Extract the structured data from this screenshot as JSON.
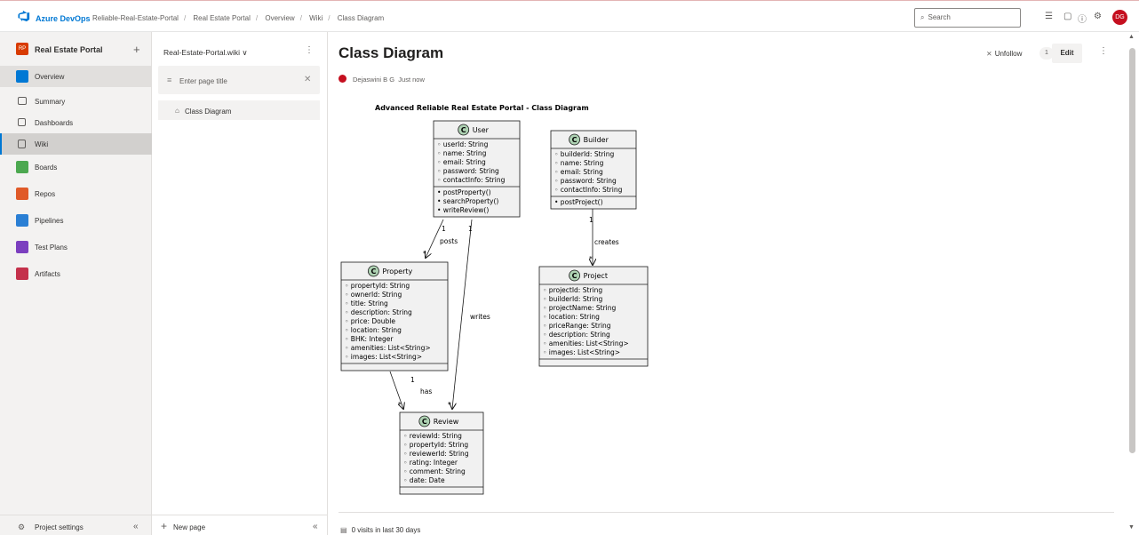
{
  "topbar": {
    "brand": "Azure DevOps",
    "breadcrumbs": [
      "Reliable-Real-Estate-Portal",
      "Real Estate Portal",
      "Overview",
      "Wiki",
      "Class Diagram"
    ],
    "search_placeholder": "Search",
    "avatar_initials": "DG"
  },
  "leftnav": {
    "project_name": "Real Estate Portal",
    "items": [
      {
        "label": "Overview",
        "icon": "overview-icon",
        "color": "#0078d4"
      },
      {
        "label": "Summary",
        "icon": "summary-icon"
      },
      {
        "label": "Dashboards",
        "icon": "dashboards-icon"
      },
      {
        "label": "Wiki",
        "icon": "wiki-icon"
      },
      {
        "label": "Boards",
        "icon": "boards-icon",
        "color": "#4ca850"
      },
      {
        "label": "Repos",
        "icon": "repos-icon",
        "color": "#e05a28"
      },
      {
        "label": "Pipelines",
        "icon": "pipelines-icon",
        "color": "#2a7fd4"
      },
      {
        "label": "Test Plans",
        "icon": "test-plans-icon",
        "color": "#7b3fbf"
      },
      {
        "label": "Artifacts",
        "icon": "artifacts-icon",
        "color": "#c4314b"
      }
    ],
    "project_settings": "Project settings"
  },
  "wiki": {
    "name": "Real-Estate-Portal.wiki",
    "filter_placeholder": "Enter page title",
    "tree_item": "Class Diagram",
    "new_page": "New page"
  },
  "page": {
    "title": "Class Diagram",
    "author": "Dejaswini B G",
    "time": "Just now",
    "unfollow": "Unfollow",
    "followers": "1",
    "edit": "Edit",
    "visits": "0 visits in last 30 days"
  },
  "diagram": {
    "title": "Advanced Reliable Real Estate Portal - Class Diagram",
    "classes": {
      "user": {
        "name": "User",
        "attrs": [
          "userId: String",
          "name: String",
          "email: String",
          "password: String",
          "contactInfo: String"
        ],
        "methods": [
          "postProperty()",
          "searchProperty()",
          "writeReview()"
        ]
      },
      "builder": {
        "name": "Builder",
        "attrs": [
          "builderId: String",
          "name: String",
          "email: String",
          "password: String",
          "contactInfo: String"
        ],
        "methods": [
          "postProject()"
        ]
      },
      "property": {
        "name": "Property",
        "attrs": [
          "propertyId: String",
          "ownerId: String",
          "title: String",
          "description: String",
          "price: Double",
          "location: String",
          "BHK: Integer",
          "amenities: List<String>",
          "images: List<String>"
        ],
        "methods": []
      },
      "project": {
        "name": "Project",
        "attrs": [
          "projectId: String",
          "builderId: String",
          "projectName: String",
          "location: String",
          "priceRange: String",
          "description: String",
          "amenities: List<String>",
          "images: List<String>"
        ],
        "methods": []
      },
      "review": {
        "name": "Review",
        "attrs": [
          "reviewId: String",
          "propertyId: String",
          "reviewerId: String",
          "rating: Integer",
          "comment: String",
          "date: Date"
        ],
        "methods": []
      }
    },
    "relations": {
      "posts": "posts",
      "writes": "writes",
      "has": "has",
      "creates": "creates",
      "one": "1",
      "many": "*"
    }
  }
}
